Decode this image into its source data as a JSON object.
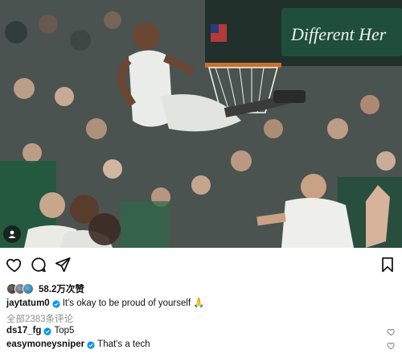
{
  "photo": {
    "alt_icons": [
      "user-tag-icon"
    ],
    "backboard_sign": "Different Here"
  },
  "actions": {
    "like_icon": "heart-outline-icon",
    "comment_icon": "comment-bubble-icon",
    "share_icon": "send-arrow-icon",
    "save_icon": "bookmark-icon"
  },
  "likes": {
    "count_text": "58.2万次赞"
  },
  "caption": {
    "username": "jaytatum0",
    "text": "It's okay to be proud of yourself 🙏"
  },
  "comments": {
    "view_all": "全部2383条评论",
    "items": [
      {
        "username": "ds17_fg",
        "verified": true,
        "text": "Top5"
      },
      {
        "username": "easymoneysniper",
        "verified": true,
        "text": "That's a tech"
      }
    ]
  },
  "colors": {
    "verified_blue": "#0095f6",
    "muted_gray": "#8e8e8e",
    "celtics_green": "#1e5a3c"
  }
}
